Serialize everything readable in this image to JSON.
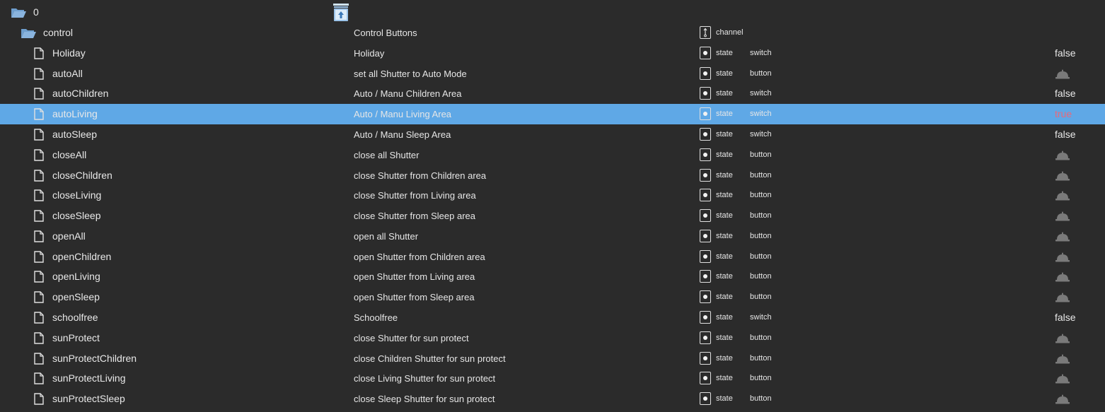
{
  "root": {
    "label": "0"
  },
  "channel": {
    "name": "control",
    "description": "Control Buttons",
    "type_label": "channel"
  },
  "states": [
    {
      "name": "Holiday",
      "description": "Holiday",
      "type_label": "state",
      "role": "switch",
      "value": "false"
    },
    {
      "name": "autoAll",
      "description": "set all Shutter to Auto Mode",
      "type_label": "state",
      "role": "button",
      "value": ""
    },
    {
      "name": "autoChildren",
      "description": "Auto / Manu Children Area",
      "type_label": "state",
      "role": "switch",
      "value": "false"
    },
    {
      "name": "autoLiving",
      "description": "Auto / Manu Living Area",
      "type_label": "state",
      "role": "switch",
      "value": "true"
    },
    {
      "name": "autoSleep",
      "description": "Auto / Manu Sleep Area",
      "type_label": "state",
      "role": "switch",
      "value": "false"
    },
    {
      "name": "closeAll",
      "description": "close all Shutter",
      "type_label": "state",
      "role": "button",
      "value": ""
    },
    {
      "name": "closeChildren",
      "description": "close Shutter from Children area",
      "type_label": "state",
      "role": "button",
      "value": ""
    },
    {
      "name": "closeLiving",
      "description": "close Shutter from Living area",
      "type_label": "state",
      "role": "button",
      "value": ""
    },
    {
      "name": "closeSleep",
      "description": "close Shutter from Sleep area",
      "type_label": "state",
      "role": "button",
      "value": ""
    },
    {
      "name": "openAll",
      "description": "open all Shutter",
      "type_label": "state",
      "role": "button",
      "value": ""
    },
    {
      "name": "openChildren",
      "description": "open Shutter from Children area",
      "type_label": "state",
      "role": "button",
      "value": ""
    },
    {
      "name": "openLiving",
      "description": "open Shutter from Living area",
      "type_label": "state",
      "role": "button",
      "value": ""
    },
    {
      "name": "openSleep",
      "description": "open Shutter from Sleep area",
      "type_label": "state",
      "role": "button",
      "value": ""
    },
    {
      "name": "schoolfree",
      "description": "Schoolfree",
      "type_label": "state",
      "role": "switch",
      "value": "false"
    },
    {
      "name": "sunProtect",
      "description": "close Shutter for sun protect",
      "type_label": "state",
      "role": "button",
      "value": ""
    },
    {
      "name": "sunProtectChildren",
      "description": "close Children Shutter for sun protect",
      "type_label": "state",
      "role": "button",
      "value": ""
    },
    {
      "name": "sunProtectLiving",
      "description": "close Living Shutter for sun protect",
      "type_label": "state",
      "role": "button",
      "value": ""
    },
    {
      "name": "sunProtectSleep",
      "description": "close Sleep Shutter for sun protect",
      "type_label": "state",
      "role": "button",
      "value": ""
    }
  ],
  "selected_state": "autoLiving",
  "colors": {
    "background": "#2b2b2b",
    "selected_row": "#5fa8e6",
    "folder_icon": "#6f9fcf",
    "true_value": "#e8697b",
    "button_icon": "#7a7a7a"
  },
  "icons": {
    "root": "folder-open-icon",
    "channel": "folder-open-icon",
    "state": "file-icon",
    "upload": "upload-icon",
    "button_action": "bell-icon"
  }
}
